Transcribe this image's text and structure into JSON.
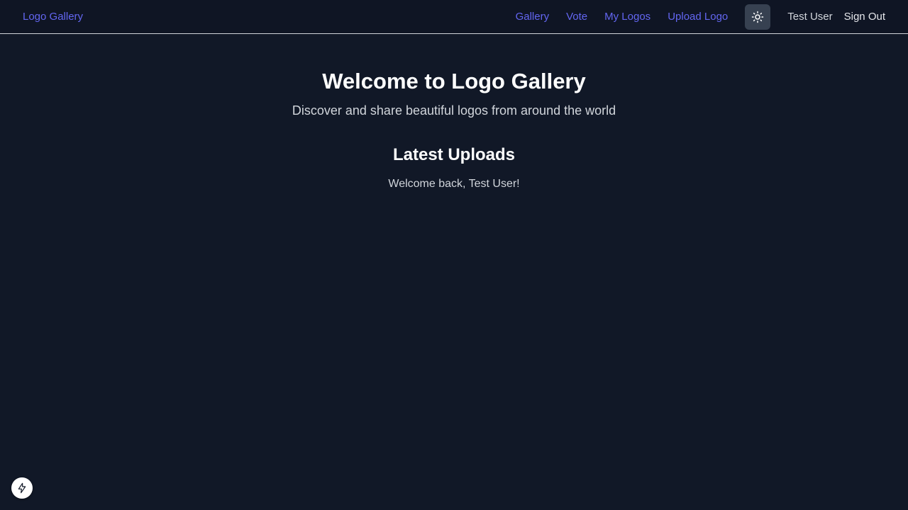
{
  "header": {
    "brand": "Logo Gallery",
    "nav": [
      {
        "label": "Gallery"
      },
      {
        "label": "Vote"
      },
      {
        "label": "My Logos"
      },
      {
        "label": "Upload Logo"
      }
    ],
    "theme_toggle_icon": "sun-icon",
    "user_name": "Test User",
    "signout_label": "Sign Out"
  },
  "main": {
    "title": "Welcome to Logo Gallery",
    "subtitle": "Discover and share beautiful logos from around the world",
    "section_title": "Latest Uploads",
    "welcome": "Welcome back, Test User!"
  },
  "floating_button": {
    "icon": "lightning-icon"
  },
  "colors": {
    "background": "#111827",
    "header_background": "#0f1524",
    "accent": "#6366f1",
    "toggle_background": "#374151",
    "muted_text": "#d1d5db"
  }
}
